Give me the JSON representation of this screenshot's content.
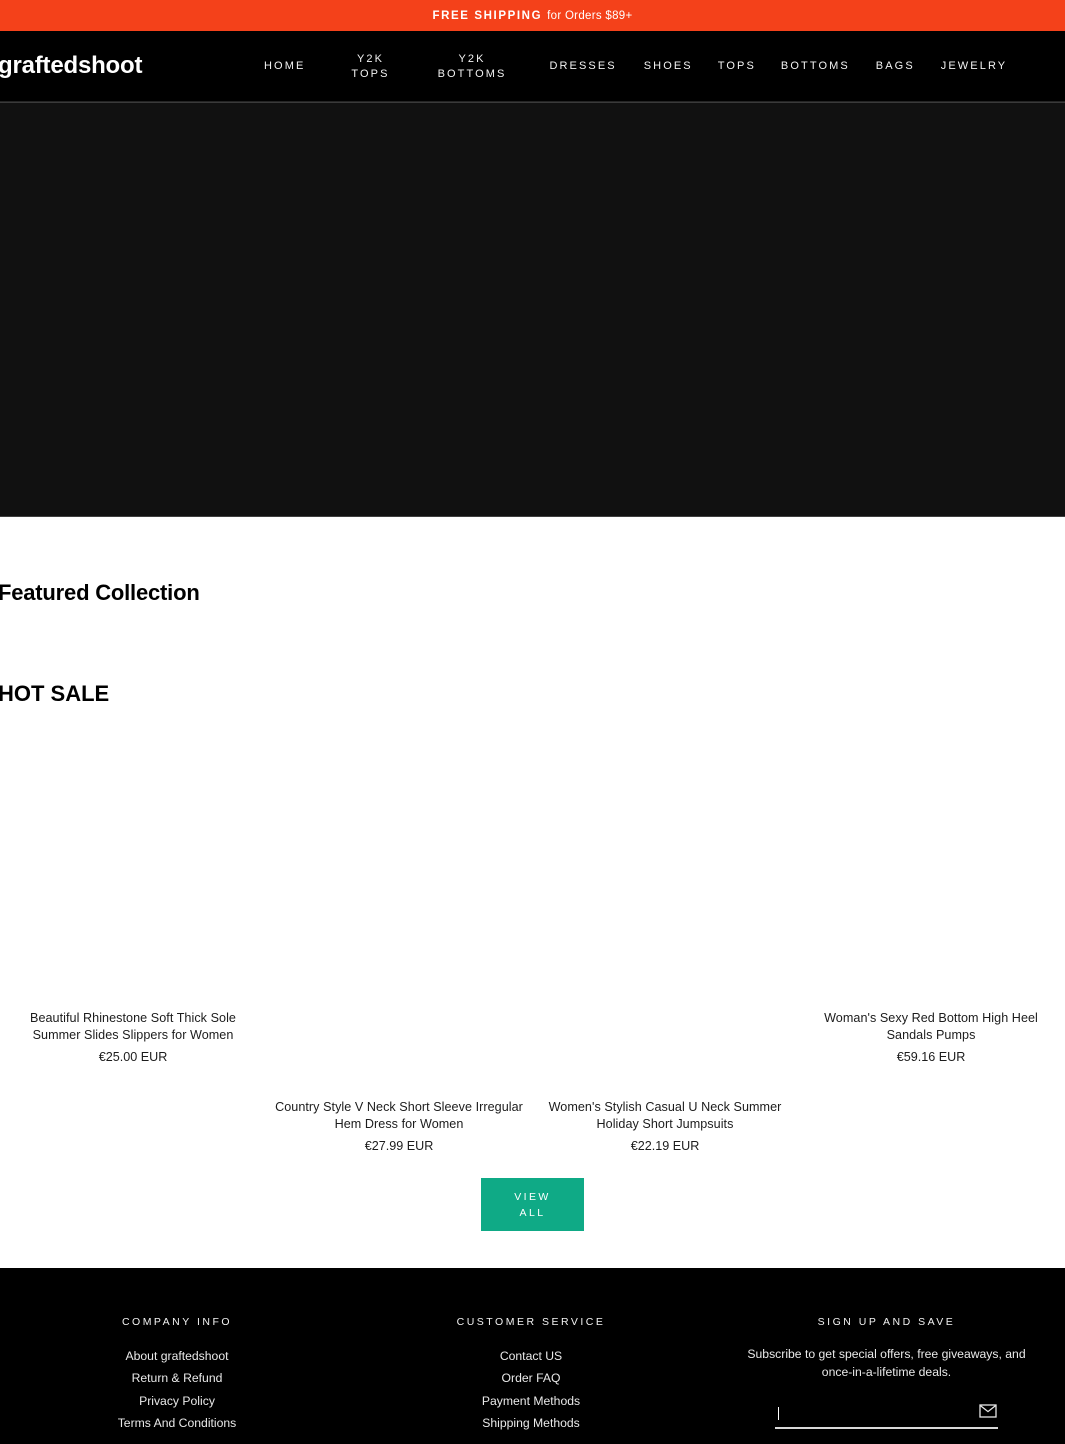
{
  "announcement": {
    "strong_text": "FREE SHIPPING",
    "light_text": "for Orders $89+",
    "background_color": "#f4411a"
  },
  "header": {
    "logo": "graftedshoot",
    "background_color": "#000000",
    "nav": [
      {
        "line1": "HOME",
        "line2": ""
      },
      {
        "line1": "Y2K",
        "line2": "TOPS"
      },
      {
        "line1": "Y2K",
        "line2": "BOTTOMS"
      },
      {
        "line1": "DRESSES",
        "line2": ""
      },
      {
        "line1": "SHOES",
        "line2": ""
      },
      {
        "line1": "TOPS",
        "line2": ""
      },
      {
        "line1": "BOTTOMS",
        "line2": ""
      },
      {
        "line1": "BAGS",
        "line2": ""
      },
      {
        "line1": "JEWELRY",
        "line2": ""
      }
    ]
  },
  "main": {
    "featured_title": "Featured Collection",
    "hot_sale_title": "HOT SALE",
    "products": [
      {
        "title": "Beautiful Rhinestone Soft Thick Sole Summer Slides Slippers for Women",
        "price": "€25.00 EUR"
      },
      {
        "title": "Country Style V Neck Short Sleeve Irregular Hem Dress for Women",
        "price": "€27.99 EUR"
      },
      {
        "title": "Women's Stylish Casual U Neck Summer Holiday Short Jumpsuits",
        "price": "€22.19 EUR"
      },
      {
        "title": "Woman's Sexy Red Bottom High Heel Sandals Pumps",
        "price": "€59.16 EUR"
      }
    ],
    "view_all": {
      "line1": "VIEW",
      "line2": "ALL",
      "color": "#0faa86"
    }
  },
  "footer": {
    "company_info": {
      "heading": "COMPANY INFO",
      "links": [
        "About graftedshoot",
        "Return & Refund",
        "Privacy Policy",
        "Terms And Conditions"
      ]
    },
    "customer_service": {
      "heading": "CUSTOMER SERVICE",
      "links": [
        "Contact US",
        "Order FAQ",
        "Payment Methods",
        "Shipping Methods"
      ]
    },
    "newsletter": {
      "heading": "SIGN UP AND SAVE",
      "description": "Subscribe to get special offers, free giveaways, and once-in-a-lifetime deals.",
      "input_value": "",
      "input_placeholder": "",
      "submit_icon": "envelope-icon"
    }
  }
}
